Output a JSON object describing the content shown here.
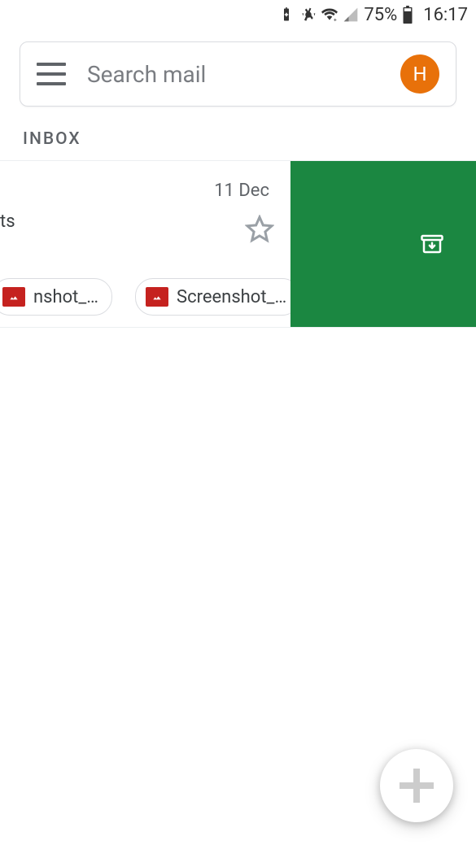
{
  "status": {
    "battery_pct": "75%",
    "time": "16:17"
  },
  "search": {
    "placeholder": "Search mail",
    "avatar_initial": "H"
  },
  "section_label": "INBOX",
  "email": {
    "date": "11 Dec",
    "subject_fragment": "ts",
    "attachments": [
      {
        "label": "nshot_…"
      },
      {
        "label": "Screenshot_…"
      }
    ]
  },
  "colors": {
    "archive_green": "#1b8741",
    "avatar_orange": "#e8710a"
  }
}
